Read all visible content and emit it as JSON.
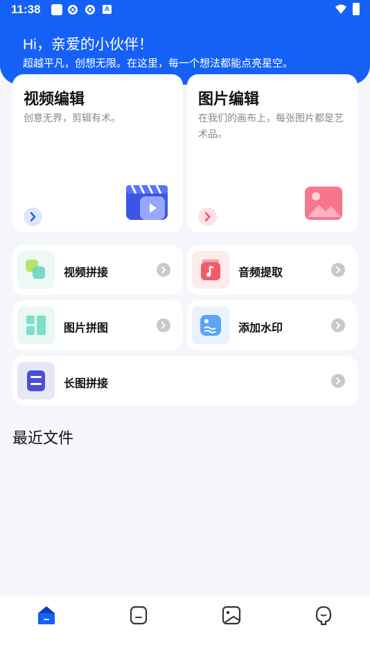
{
  "status_bar": {
    "time": "11:38",
    "notification_letter": "A"
  },
  "header": {
    "greeting": "Hi，亲爱的小伙伴！",
    "subtitle": "超越平凡，创想无限。在这里，每一个想法都能点亮星空。"
  },
  "feature_cards": [
    {
      "title": "视频编辑",
      "description": "创意无界，剪辑有术。",
      "icon": "video-clapper-icon"
    },
    {
      "title": "图片编辑",
      "description": "在我们的画布上，每张图片都是艺术品。",
      "icon": "image-icon"
    }
  ],
  "tools": [
    {
      "label": "视频拼接",
      "icon": "merge-icon"
    },
    {
      "label": "音频提取",
      "icon": "music-note-icon"
    },
    {
      "label": "图片拼图",
      "icon": "grid-icon"
    },
    {
      "label": "添加水印",
      "icon": "watermark-icon"
    },
    {
      "label": "长图拼接",
      "icon": "long-image-icon"
    }
  ],
  "recent": {
    "title": "最近文件"
  },
  "bottom_nav": [
    {
      "id": "home",
      "icon": "home-icon",
      "active": true
    },
    {
      "id": "templates",
      "icon": "note-icon",
      "active": false
    },
    {
      "id": "gallery",
      "icon": "photo-icon",
      "active": false
    },
    {
      "id": "profile",
      "icon": "profile-icon",
      "active": false
    }
  ],
  "colors": {
    "primary": "#1561f6",
    "background": "#f4f6fb",
    "pink": "#f0627a"
  }
}
